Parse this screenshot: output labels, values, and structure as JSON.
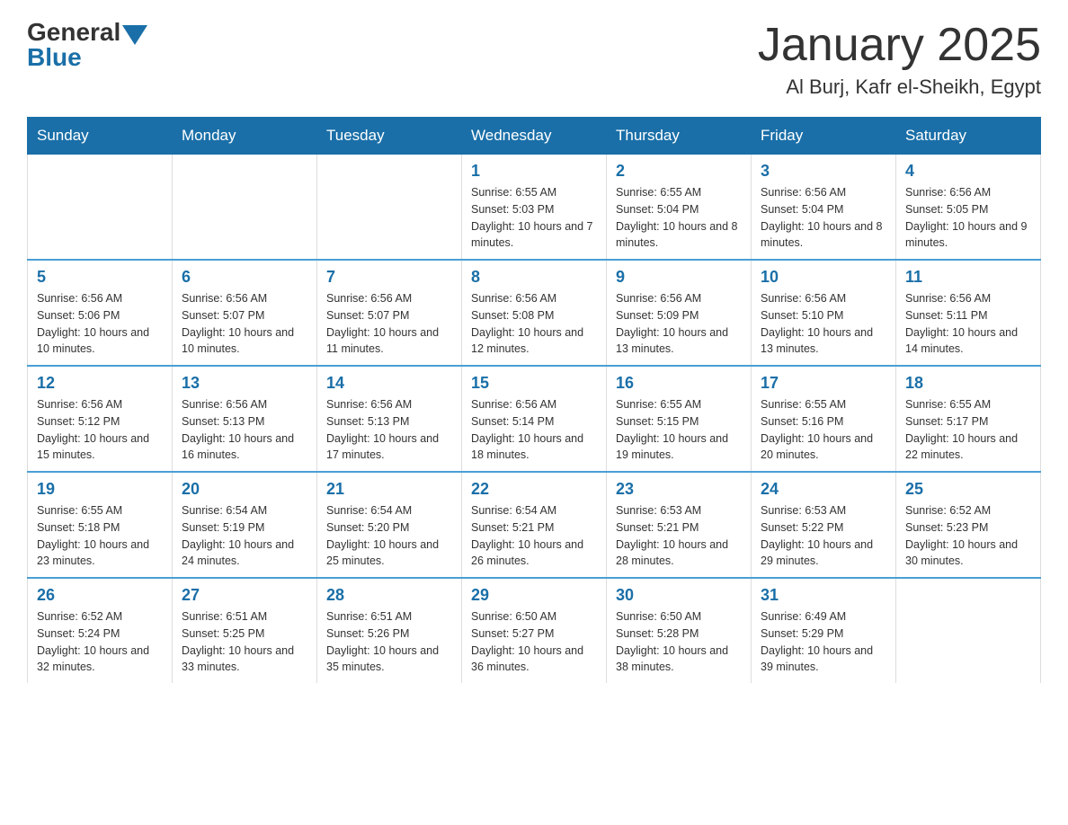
{
  "header": {
    "logo_general": "General",
    "logo_blue": "Blue",
    "month_title": "January 2025",
    "location": "Al Burj, Kafr el-Sheikh, Egypt"
  },
  "days_of_week": [
    "Sunday",
    "Monday",
    "Tuesday",
    "Wednesday",
    "Thursday",
    "Friday",
    "Saturday"
  ],
  "weeks": [
    [
      {
        "day": "",
        "info": ""
      },
      {
        "day": "",
        "info": ""
      },
      {
        "day": "",
        "info": ""
      },
      {
        "day": "1",
        "info": "Sunrise: 6:55 AM\nSunset: 5:03 PM\nDaylight: 10 hours and 7 minutes."
      },
      {
        "day": "2",
        "info": "Sunrise: 6:55 AM\nSunset: 5:04 PM\nDaylight: 10 hours and 8 minutes."
      },
      {
        "day": "3",
        "info": "Sunrise: 6:56 AM\nSunset: 5:04 PM\nDaylight: 10 hours and 8 minutes."
      },
      {
        "day": "4",
        "info": "Sunrise: 6:56 AM\nSunset: 5:05 PM\nDaylight: 10 hours and 9 minutes."
      }
    ],
    [
      {
        "day": "5",
        "info": "Sunrise: 6:56 AM\nSunset: 5:06 PM\nDaylight: 10 hours and 10 minutes."
      },
      {
        "day": "6",
        "info": "Sunrise: 6:56 AM\nSunset: 5:07 PM\nDaylight: 10 hours and 10 minutes."
      },
      {
        "day": "7",
        "info": "Sunrise: 6:56 AM\nSunset: 5:07 PM\nDaylight: 10 hours and 11 minutes."
      },
      {
        "day": "8",
        "info": "Sunrise: 6:56 AM\nSunset: 5:08 PM\nDaylight: 10 hours and 12 minutes."
      },
      {
        "day": "9",
        "info": "Sunrise: 6:56 AM\nSunset: 5:09 PM\nDaylight: 10 hours and 13 minutes."
      },
      {
        "day": "10",
        "info": "Sunrise: 6:56 AM\nSunset: 5:10 PM\nDaylight: 10 hours and 13 minutes."
      },
      {
        "day": "11",
        "info": "Sunrise: 6:56 AM\nSunset: 5:11 PM\nDaylight: 10 hours and 14 minutes."
      }
    ],
    [
      {
        "day": "12",
        "info": "Sunrise: 6:56 AM\nSunset: 5:12 PM\nDaylight: 10 hours and 15 minutes."
      },
      {
        "day": "13",
        "info": "Sunrise: 6:56 AM\nSunset: 5:13 PM\nDaylight: 10 hours and 16 minutes."
      },
      {
        "day": "14",
        "info": "Sunrise: 6:56 AM\nSunset: 5:13 PM\nDaylight: 10 hours and 17 minutes."
      },
      {
        "day": "15",
        "info": "Sunrise: 6:56 AM\nSunset: 5:14 PM\nDaylight: 10 hours and 18 minutes."
      },
      {
        "day": "16",
        "info": "Sunrise: 6:55 AM\nSunset: 5:15 PM\nDaylight: 10 hours and 19 minutes."
      },
      {
        "day": "17",
        "info": "Sunrise: 6:55 AM\nSunset: 5:16 PM\nDaylight: 10 hours and 20 minutes."
      },
      {
        "day": "18",
        "info": "Sunrise: 6:55 AM\nSunset: 5:17 PM\nDaylight: 10 hours and 22 minutes."
      }
    ],
    [
      {
        "day": "19",
        "info": "Sunrise: 6:55 AM\nSunset: 5:18 PM\nDaylight: 10 hours and 23 minutes."
      },
      {
        "day": "20",
        "info": "Sunrise: 6:54 AM\nSunset: 5:19 PM\nDaylight: 10 hours and 24 minutes."
      },
      {
        "day": "21",
        "info": "Sunrise: 6:54 AM\nSunset: 5:20 PM\nDaylight: 10 hours and 25 minutes."
      },
      {
        "day": "22",
        "info": "Sunrise: 6:54 AM\nSunset: 5:21 PM\nDaylight: 10 hours and 26 minutes."
      },
      {
        "day": "23",
        "info": "Sunrise: 6:53 AM\nSunset: 5:21 PM\nDaylight: 10 hours and 28 minutes."
      },
      {
        "day": "24",
        "info": "Sunrise: 6:53 AM\nSunset: 5:22 PM\nDaylight: 10 hours and 29 minutes."
      },
      {
        "day": "25",
        "info": "Sunrise: 6:52 AM\nSunset: 5:23 PM\nDaylight: 10 hours and 30 minutes."
      }
    ],
    [
      {
        "day": "26",
        "info": "Sunrise: 6:52 AM\nSunset: 5:24 PM\nDaylight: 10 hours and 32 minutes."
      },
      {
        "day": "27",
        "info": "Sunrise: 6:51 AM\nSunset: 5:25 PM\nDaylight: 10 hours and 33 minutes."
      },
      {
        "day": "28",
        "info": "Sunrise: 6:51 AM\nSunset: 5:26 PM\nDaylight: 10 hours and 35 minutes."
      },
      {
        "day": "29",
        "info": "Sunrise: 6:50 AM\nSunset: 5:27 PM\nDaylight: 10 hours and 36 minutes."
      },
      {
        "day": "30",
        "info": "Sunrise: 6:50 AM\nSunset: 5:28 PM\nDaylight: 10 hours and 38 minutes."
      },
      {
        "day": "31",
        "info": "Sunrise: 6:49 AM\nSunset: 5:29 PM\nDaylight: 10 hours and 39 minutes."
      },
      {
        "day": "",
        "info": ""
      }
    ]
  ]
}
